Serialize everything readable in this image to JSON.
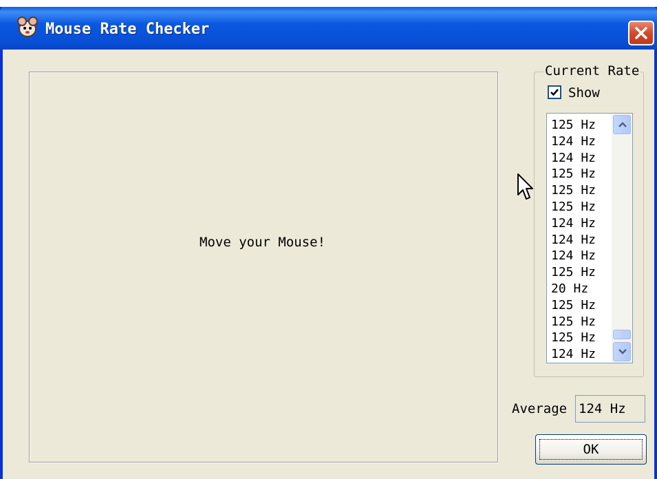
{
  "window": {
    "title": "Mouse Rate Checker"
  },
  "canvas": {
    "message": "Move your Mouse!"
  },
  "current_rate": {
    "group_label": "Current Rate",
    "show_label": "Show",
    "show_checked": true,
    "rates": [
      "125 Hz",
      "124 Hz",
      "124 Hz",
      "125 Hz",
      "125 Hz",
      "125 Hz",
      "124 Hz",
      "124 Hz",
      "124 Hz",
      "125 Hz",
      "20 Hz",
      "125 Hz",
      "125 Hz",
      "125 Hz",
      "124 Hz"
    ]
  },
  "average": {
    "label": "Average",
    "value": "124 Hz"
  },
  "buttons": {
    "ok_label": "OK"
  },
  "colors": {
    "titlebar": "#0850d6",
    "close": "#d24a2b",
    "window_bg": "#ece9d8"
  },
  "icons": [
    "app-mouse-icon",
    "close-icon",
    "checkmark-icon",
    "scroll-up-icon",
    "scroll-down-icon",
    "mouse-cursor-icon"
  ]
}
